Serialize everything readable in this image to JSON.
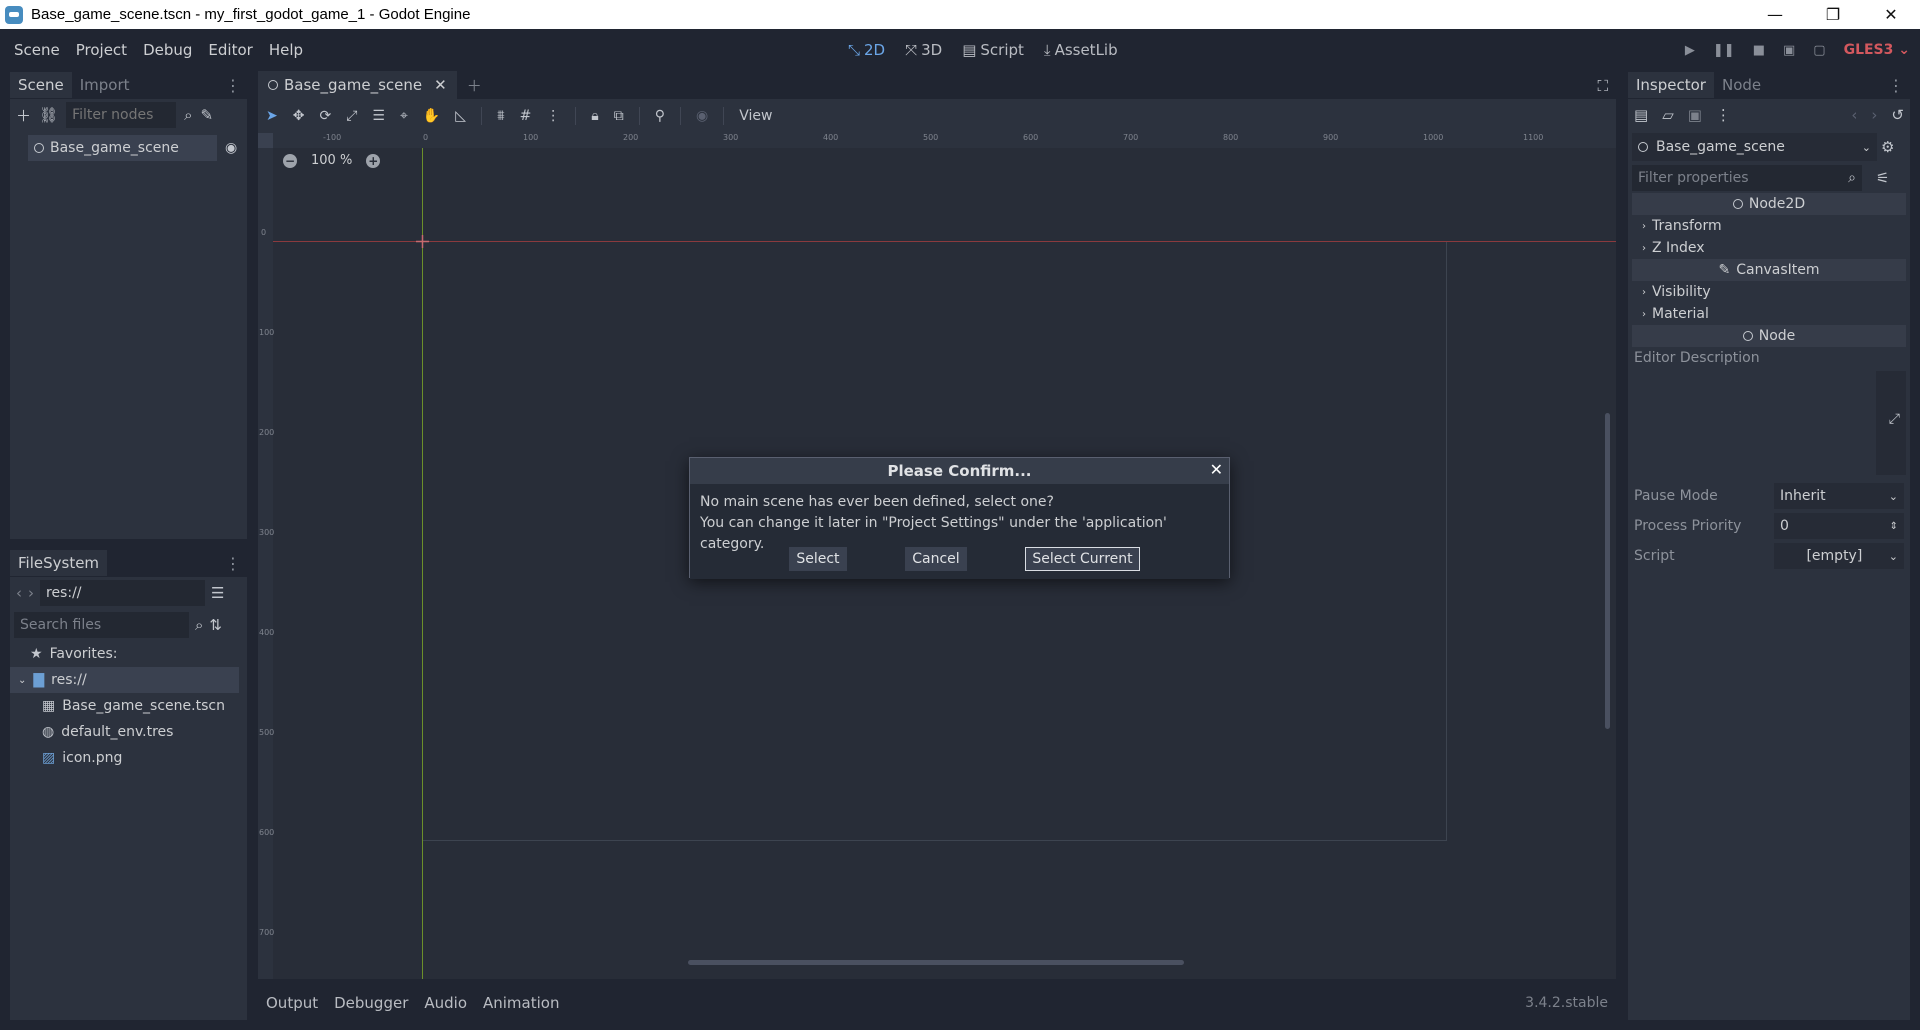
{
  "window": {
    "title": "Base_game_scene.tscn - my_first_godot_game_1 - Godot Engine",
    "minimize": "—",
    "maximize": "❐",
    "close": "✕"
  },
  "menu": {
    "items": [
      "Scene",
      "Project",
      "Debug",
      "Editor",
      "Help"
    ]
  },
  "workspaces": [
    {
      "label": "2D",
      "icon": "2d-icon"
    },
    {
      "label": "3D",
      "icon": "3d-icon"
    },
    {
      "label": "Script",
      "icon": "script-icon"
    },
    {
      "label": "AssetLib",
      "icon": "assetlib-icon"
    }
  ],
  "renderer": "GLES3",
  "scene_dock": {
    "tabs": [
      "Scene",
      "Import"
    ],
    "filter_placeholder": "Filter nodes",
    "root_node": "Base_game_scene"
  },
  "filesystem": {
    "tab": "FileSystem",
    "path": "res://",
    "search_placeholder": "Search files",
    "favorites": "Favorites:",
    "root": "res://",
    "files": [
      {
        "name": "Base_game_scene.tscn",
        "icon": "scene-file-icon"
      },
      {
        "name": "default_env.tres",
        "icon": "environment-icon"
      },
      {
        "name": "icon.png",
        "icon": "image-icon"
      }
    ]
  },
  "editor": {
    "scene_tab": "Base_game_scene",
    "view_menu": "View",
    "zoom": "100 %",
    "ruler_top": [
      "-100",
      "0",
      "100",
      "200",
      "300",
      "400",
      "500",
      "600",
      "700",
      "800",
      "900",
      "1000",
      "1100"
    ],
    "ruler_left": [
      "0",
      "100",
      "200",
      "300",
      "400",
      "500",
      "600",
      "700"
    ]
  },
  "bottom": {
    "tabs": [
      "Output",
      "Debugger",
      "Audio",
      "Animation"
    ],
    "version": "3.4.2.stable"
  },
  "inspector": {
    "tabs": [
      "Inspector",
      "Node"
    ],
    "node_name": "Base_game_scene",
    "filter_placeholder": "Filter properties",
    "categories": {
      "node2d": "Node2D",
      "canvas_item": "CanvasItem",
      "node": "Node"
    },
    "sections": {
      "transform": "Transform",
      "z_index": "Z Index",
      "visibility": "Visibility",
      "material": "Material"
    },
    "editor_description": "Editor Description",
    "props": {
      "pause_mode_label": "Pause Mode",
      "pause_mode_value": "Inherit",
      "process_priority_label": "Process Priority",
      "process_priority_value": "0",
      "script_label": "Script",
      "script_value": "[empty]"
    }
  },
  "dialog": {
    "title": "Please Confirm...",
    "line1": "No main scene has ever been defined, select one?",
    "line2": "You can change it later in \"Project Settings\" under the 'application' category.",
    "select": "Select",
    "cancel": "Cancel",
    "select_current": "Select Current"
  },
  "colors": {
    "background": "#202531",
    "panel": "#2c323e",
    "accent": "#6ba6e8",
    "gles": "#d3585e"
  }
}
